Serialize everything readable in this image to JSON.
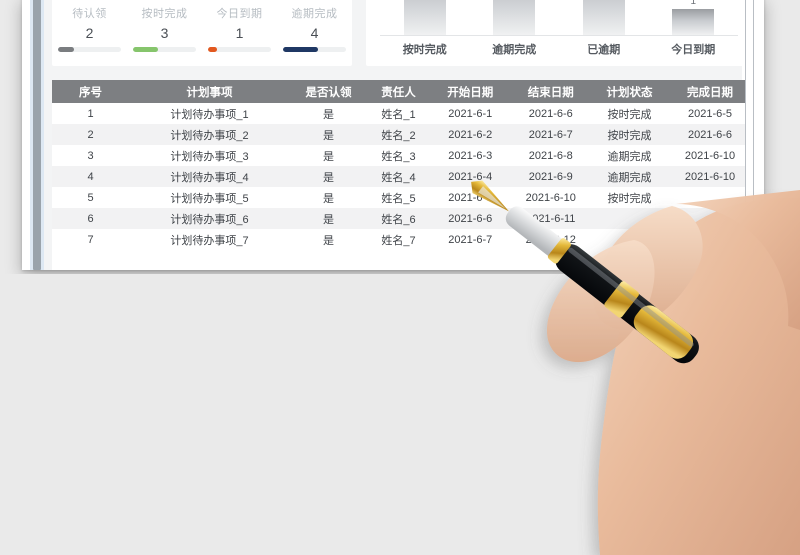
{
  "window": {
    "background_color": "#eaeaea",
    "panel_color": "#ffffff"
  },
  "stats": {
    "items": [
      {
        "label": "待认领",
        "value": "2",
        "fill_pct": 26,
        "color": "#7a7d80"
      },
      {
        "label": "按时完成",
        "value": "3",
        "fill_pct": 40,
        "color": "#86c56c"
      },
      {
        "label": "今日到期",
        "value": "1",
        "fill_pct": 14,
        "color": "#e2581f"
      },
      {
        "label": "逾期完成",
        "value": "4",
        "fill_pct": 56,
        "color": "#1f3864"
      }
    ]
  },
  "chart_data": {
    "type": "bar",
    "title": "",
    "xlabel": "",
    "ylabel": "",
    "categories": [
      "按时完成",
      "逾期完成",
      "已逾期",
      "今日到期"
    ],
    "values": [
      3,
      3,
      2,
      1
    ],
    "data_labels": [
      "",
      "",
      "",
      "1"
    ],
    "ylim": [
      0,
      3
    ],
    "grid": false,
    "legend": "none",
    "bar_gradient_top": "#9a9da1",
    "bar_gradient_bottom": "#f0f1f2",
    "axis_line_color": "#e3e5e7"
  },
  "table": {
    "header_bg": "#7d7f82",
    "columns": [
      "序号",
      "计划事项",
      "是否认领",
      "责任人",
      "开始日期",
      "结束日期",
      "计划状态",
      "完成日期"
    ],
    "rows": [
      [
        "1",
        "计划待办事项_1",
        "是",
        "姓名_1",
        "2021-6-1",
        "2021-6-6",
        "按时完成",
        "2021-6-5"
      ],
      [
        "2",
        "计划待办事项_2",
        "是",
        "姓名_2",
        "2021-6-2",
        "2021-6-7",
        "按时完成",
        "2021-6-6"
      ],
      [
        "3",
        "计划待办事项_3",
        "是",
        "姓名_3",
        "2021-6-3",
        "2021-6-8",
        "逾期完成",
        "2021-6-10"
      ],
      [
        "4",
        "计划待办事项_4",
        "是",
        "姓名_4",
        "2021-6-4",
        "2021-6-9",
        "逾期完成",
        "2021-6-10"
      ],
      [
        "5",
        "计划待办事项_5",
        "是",
        "姓名_5",
        "2021-6-5",
        "2021-6-10",
        "按时完成",
        ""
      ],
      [
        "6",
        "计划待办事项_6",
        "是",
        "姓名_6",
        "2021-6-6",
        "2021-6-11",
        "",
        ""
      ],
      [
        "7",
        "计划待办事项_7",
        "是",
        "姓名_7",
        "2021-6-7",
        "2021-6-12",
        "",
        ""
      ]
    ]
  },
  "overlay": {
    "hand_description": "hand-holding-fountain-pen",
    "pen_body_color": "#16181a",
    "pen_trim_color": "#d4a529",
    "skin_color": "#e8bb9a"
  }
}
